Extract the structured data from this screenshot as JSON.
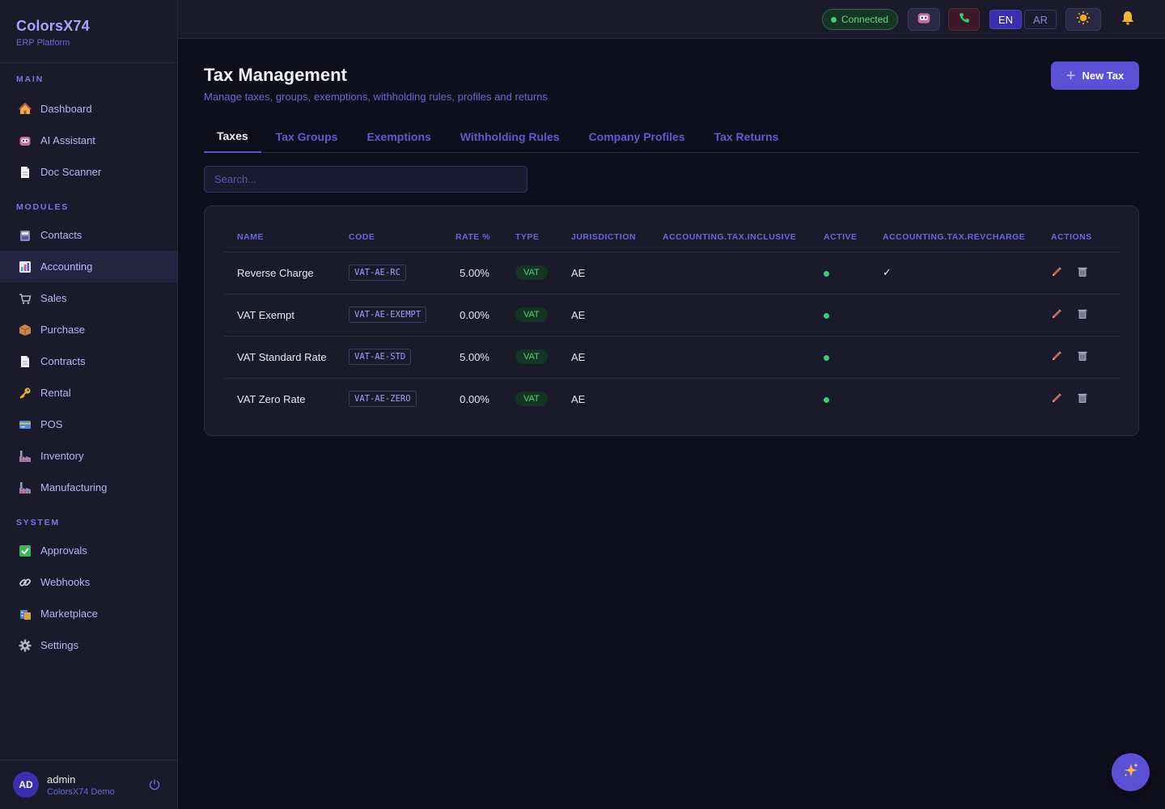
{
  "brand": {
    "title": "ColorsX74",
    "subtitle": "ERP Platform"
  },
  "sidebar": {
    "sections": [
      {
        "label": "MAIN",
        "items": [
          {
            "label": "Dashboard",
            "icon": "house-icon"
          },
          {
            "label": "AI Assistant",
            "icon": "robot-icon"
          },
          {
            "label": "Doc Scanner",
            "icon": "document-icon"
          }
        ]
      },
      {
        "label": "MODULES",
        "items": [
          {
            "label": "Contacts",
            "icon": "contacts-icon"
          },
          {
            "label": "Accounting",
            "icon": "chart-icon",
            "active": true
          },
          {
            "label": "Sales",
            "icon": "cart-icon"
          },
          {
            "label": "Purchase",
            "icon": "package-icon"
          },
          {
            "label": "Contracts",
            "icon": "document-icon"
          },
          {
            "label": "Rental",
            "icon": "key-icon"
          },
          {
            "label": "POS",
            "icon": "card-icon"
          },
          {
            "label": "Inventory",
            "icon": "factory-icon"
          },
          {
            "label": "Manufacturing",
            "icon": "factory-icon"
          }
        ]
      },
      {
        "label": "SYSTEM",
        "items": [
          {
            "label": "Approvals",
            "icon": "check-icon"
          },
          {
            "label": "Webhooks",
            "icon": "link-icon"
          },
          {
            "label": "Marketplace",
            "icon": "shop-icon"
          },
          {
            "label": "Settings",
            "icon": "gear-icon"
          }
        ]
      }
    ]
  },
  "user": {
    "initials": "AD",
    "name": "admin",
    "org": "ColorsX74 Demo"
  },
  "topbar": {
    "status": "Connected",
    "lang_en": "EN",
    "lang_ar": "AR",
    "colors": {
      "status_green": "#3bd26b",
      "accent": "#5b51d6"
    }
  },
  "page": {
    "title": "Tax Management",
    "subtitle": "Manage taxes, groups, exemptions, withholding rules, profiles and returns",
    "new_button": "New Tax",
    "tabs": [
      "Taxes",
      "Tax Groups",
      "Exemptions",
      "Withholding Rules",
      "Company Profiles",
      "Tax Returns"
    ],
    "active_tab": "Taxes",
    "search_placeholder": "Search..."
  },
  "table": {
    "columns": [
      "NAME",
      "CODE",
      "RATE %",
      "TYPE",
      "JURISDICTION",
      "ACCOUNTING.TAX.INCLUSIVE",
      "ACTIVE",
      "ACCOUNTING.TAX.REVCHARGE",
      "ACTIONS"
    ],
    "rows": [
      {
        "name": "Reverse Charge",
        "code": "VAT-AE-RC",
        "rate": "5.00%",
        "type": "VAT",
        "jurisdiction": "AE",
        "inclusive": "",
        "active": true,
        "revcharge": "✓"
      },
      {
        "name": "VAT Exempt",
        "code": "VAT-AE-EXEMPT",
        "rate": "0.00%",
        "type": "VAT",
        "jurisdiction": "AE",
        "inclusive": "",
        "active": true,
        "revcharge": ""
      },
      {
        "name": "VAT Standard Rate",
        "code": "VAT-AE-STD",
        "rate": "5.00%",
        "type": "VAT",
        "jurisdiction": "AE",
        "inclusive": "",
        "active": true,
        "revcharge": ""
      },
      {
        "name": "VAT Zero Rate",
        "code": "VAT-AE-ZERO",
        "rate": "0.00%",
        "type": "VAT",
        "jurisdiction": "AE",
        "inclusive": "",
        "active": true,
        "revcharge": ""
      }
    ]
  }
}
